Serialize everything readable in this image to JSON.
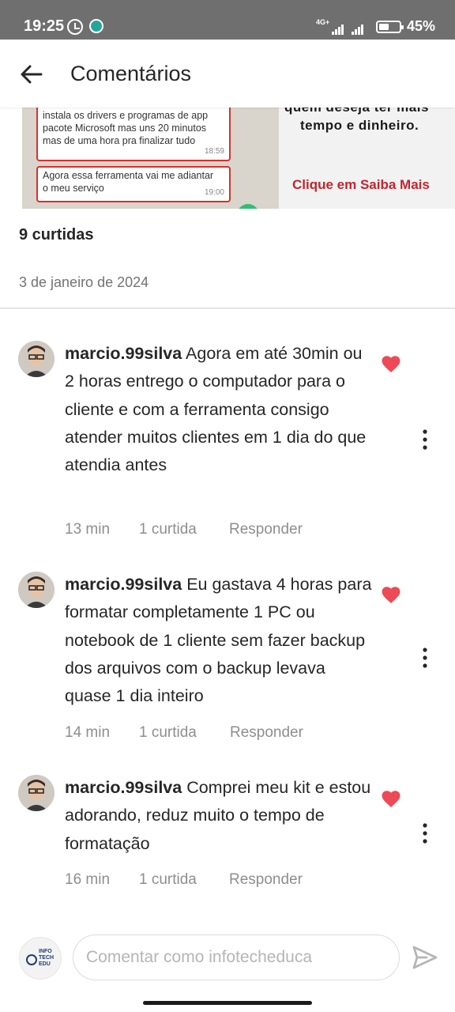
{
  "status_bar": {
    "time": "19:25",
    "network": "4G+",
    "battery": "45%"
  },
  "header": {
    "title": "Comentários",
    "back_icon": "arrow-left-icon"
  },
  "post": {
    "image_chat": {
      "message1_lines": [
        "instala os drivers e programas de app",
        "pacote Microsoft mas uns 20 minutos",
        "mas de uma hora pra finalizar tudo"
      ],
      "message1_time": "18:59",
      "message2_lines": [
        "Agora essa ferramenta vai me adiantar",
        "o meu serviço"
      ],
      "message2_time": "19:00"
    },
    "image_ad": {
      "line_partial": "quem deseja ter mais",
      "line": "tempo e dinheiro.",
      "cta": "Clique em Saiba Mais"
    },
    "likes": "9 curtidas",
    "date": "3 de janeiro de 2024"
  },
  "comments": [
    {
      "username": "marcio.99silva",
      "text": "Agora em até 30min ou 2 horas entrego o computador para o cliente e com a ferramenta consigo atender muitos clientes em 1 dia do que atendia antes",
      "time": "13 min",
      "likes": "1 curtida",
      "reply": "Responder",
      "liked": true
    },
    {
      "username": "marcio.99silva",
      "text": "Eu gastava 4 horas para formatar completamente 1 PC ou notebook de 1 cliente sem fazer backup dos arquivos com o backup levava quase 1 dia inteiro",
      "time": "14 min",
      "likes": "1 curtida",
      "reply": "Responder",
      "liked": true
    },
    {
      "username": "marcio.99silva",
      "text": "Comprei meu kit e estou adorando, reduz muito o tempo de formatação",
      "time": "16 min",
      "likes": "1 curtida",
      "reply": "Responder",
      "liked": true
    }
  ],
  "composer": {
    "avatar_text": "INFO TECH EDU",
    "placeholder": "Comentar como infotecheduca",
    "send_icon": "send-icon"
  },
  "colors": {
    "like_heart": "#ed4956",
    "muted_text": "#8e8e8e",
    "status_bar": "#6f6f6f"
  }
}
